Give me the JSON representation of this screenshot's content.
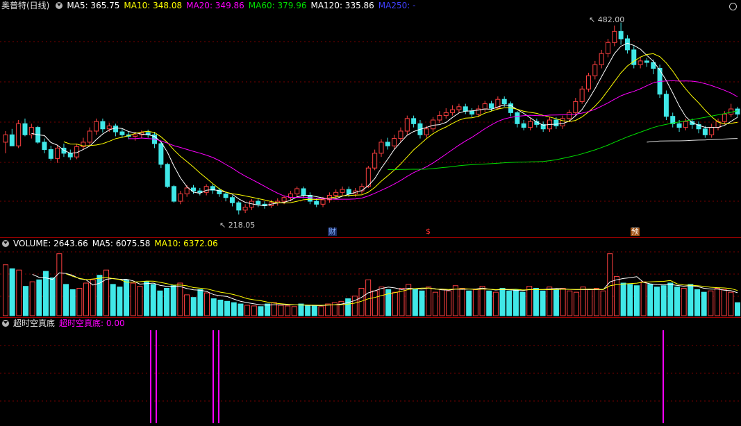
{
  "price_header": {
    "title": "奥普特(日线)",
    "items": [
      {
        "label": "MA5: 365.75",
        "color": "#ffffff"
      },
      {
        "label": "MA10: 348.08",
        "color": "#ffff00"
      },
      {
        "label": "MA20: 349.86",
        "color": "#ff00ff"
      },
      {
        "label": "MA60: 379.96",
        "color": "#00e000"
      },
      {
        "label": "MA120: 335.86",
        "color": "#ffffff"
      },
      {
        "label": "MA250: -",
        "color": "#4040ff"
      }
    ]
  },
  "volume_header": {
    "items": [
      {
        "label": "VOLUME: 2643.66",
        "color": "#ffffff"
      },
      {
        "label": "MA5: 6075.58",
        "color": "#ffffff"
      },
      {
        "label": "MA10: 6372.06",
        "color": "#ffff00"
      }
    ]
  },
  "indicator_header": {
    "name": "超时空真底",
    "value_label": "超时空真底: 0.00",
    "value_color": "#ff00ff"
  },
  "annotations": {
    "high_label": "482.00",
    "low_label": "218.05"
  },
  "event_markers": [
    {
      "label": "财",
      "color": "#80b0ff",
      "bg": "#1a2a60"
    },
    {
      "label": "$",
      "color": "#ff3030",
      "bg": "transparent"
    },
    {
      "label": "预",
      "color": "#ffffff",
      "bg": "#a05010"
    }
  ],
  "colors": {
    "up": "#ff4040",
    "down": "#40e8e8",
    "grid": "#7a0000",
    "signal": "#ff00ff"
  },
  "chart_data": {
    "type": "candlestick",
    "price_range": [
      218.05,
      482.0
    ],
    "candles": [
      [
        320,
        330,
        305,
        335,
        300
      ],
      [
        330,
        315,
        318,
        338,
        312
      ],
      [
        315,
        345,
        312,
        350,
        310
      ],
      [
        345,
        330,
        328,
        352,
        325
      ],
      [
        330,
        340,
        325,
        345,
        320
      ],
      [
        340,
        320,
        318,
        342,
        315
      ],
      [
        320,
        310,
        305,
        325,
        300
      ],
      [
        310,
        298,
        295,
        315,
        290
      ],
      [
        298,
        312,
        292,
        316,
        290
      ],
      [
        312,
        305,
        300,
        318,
        298
      ],
      [
        305,
        300,
        296,
        310,
        295
      ],
      [
        300,
        314,
        297,
        318,
        295
      ],
      [
        314,
        320,
        310,
        326,
        306
      ],
      [
        320,
        335,
        315,
        340,
        312
      ],
      [
        335,
        348,
        330,
        352,
        326
      ],
      [
        348,
        338,
        333,
        352,
        330
      ],
      [
        338,
        342,
        334,
        346,
        330
      ],
      [
        342,
        334,
        328,
        345,
        325
      ],
      [
        334,
        330,
        326,
        338,
        322
      ],
      [
        330,
        328,
        324,
        334,
        320
      ],
      [
        328,
        330,
        322,
        334,
        318
      ],
      [
        330,
        333,
        326,
        336,
        322
      ],
      [
        333,
        330,
        326,
        337,
        324
      ],
      [
        330,
        318,
        312,
        334,
        308
      ],
      [
        318,
        290,
        285,
        320,
        280
      ],
      [
        290,
        260,
        258,
        292,
        255
      ],
      [
        260,
        240,
        238,
        262,
        232
      ],
      [
        240,
        250,
        236,
        254,
        234
      ],
      [
        250,
        258,
        246,
        262,
        244
      ],
      [
        258,
        254,
        250,
        262,
        248
      ],
      [
        254,
        252,
        248,
        258,
        246
      ],
      [
        252,
        260,
        248,
        263,
        246
      ],
      [
        260,
        255,
        250,
        263,
        248
      ],
      [
        255,
        250,
        246,
        258,
        244
      ],
      [
        250,
        245,
        240,
        253,
        238
      ],
      [
        245,
        238,
        233,
        248,
        230
      ],
      [
        238,
        228,
        222,
        240,
        218
      ],
      [
        228,
        232,
        224,
        236,
        222
      ],
      [
        232,
        240,
        228,
        243,
        226
      ],
      [
        240,
        236,
        232,
        244,
        230
      ],
      [
        236,
        234,
        230,
        240,
        228
      ],
      [
        234,
        238,
        231,
        242,
        229
      ],
      [
        238,
        240,
        234,
        244,
        232
      ],
      [
        240,
        245,
        236,
        248,
        234
      ],
      [
        245,
        250,
        240,
        254,
        238
      ],
      [
        250,
        257,
        246,
        260,
        244
      ],
      [
        257,
        248,
        244,
        260,
        242
      ],
      [
        248,
        240,
        236,
        252,
        234
      ],
      [
        240,
        236,
        232,
        244,
        230
      ],
      [
        236,
        242,
        232,
        246,
        230
      ],
      [
        242,
        248,
        238,
        252,
        236
      ],
      [
        248,
        252,
        244,
        256,
        242
      ],
      [
        252,
        256,
        248,
        260,
        246
      ],
      [
        256,
        250,
        246,
        260,
        244
      ],
      [
        250,
        254,
        246,
        258,
        244
      ],
      [
        254,
        260,
        250,
        264,
        248
      ],
      [
        260,
        285,
        258,
        288,
        256
      ],
      [
        285,
        305,
        282,
        310,
        280
      ],
      [
        305,
        320,
        300,
        324,
        298
      ],
      [
        320,
        315,
        310,
        326,
        308
      ],
      [
        315,
        325,
        310,
        330,
        308
      ],
      [
        325,
        335,
        320,
        340,
        318
      ],
      [
        335,
        352,
        330,
        356,
        328
      ],
      [
        352,
        345,
        340,
        356,
        338
      ],
      [
        345,
        330,
        325,
        350,
        322
      ],
      [
        330,
        338,
        326,
        342,
        324
      ],
      [
        338,
        350,
        334,
        354,
        330
      ],
      [
        350,
        356,
        346,
        362,
        344
      ],
      [
        356,
        360,
        352,
        366,
        350
      ],
      [
        360,
        364,
        356,
        370,
        354
      ],
      [
        364,
        368,
        360,
        372,
        356
      ],
      [
        368,
        362,
        358,
        372,
        355
      ],
      [
        362,
        358,
        354,
        366,
        350
      ],
      [
        358,
        365,
        354,
        370,
        352
      ],
      [
        365,
        372,
        361,
        376,
        358
      ],
      [
        372,
        366,
        362,
        376,
        360
      ],
      [
        366,
        378,
        364,
        382,
        362
      ],
      [
        378,
        372,
        368,
        382,
        365
      ],
      [
        372,
        360,
        355,
        375,
        350
      ],
      [
        360,
        345,
        340,
        362,
        338
      ],
      [
        345,
        340,
        336,
        350,
        334
      ],
      [
        340,
        348,
        336,
        352,
        334
      ],
      [
        348,
        344,
        340,
        352,
        338
      ],
      [
        344,
        338,
        334,
        348,
        332
      ],
      [
        338,
        350,
        334,
        354,
        332
      ],
      [
        350,
        342,
        338,
        354,
        336
      ],
      [
        342,
        352,
        338,
        356,
        336
      ],
      [
        352,
        360,
        348,
        364,
        346
      ],
      [
        360,
        375,
        356,
        380,
        354
      ],
      [
        375,
        392,
        372,
        396,
        370
      ],
      [
        392,
        410,
        388,
        414,
        386
      ],
      [
        410,
        425,
        405,
        430,
        402
      ],
      [
        425,
        440,
        420,
        445,
        418
      ],
      [
        440,
        455,
        435,
        460,
        432
      ],
      [
        455,
        470,
        450,
        478,
        448
      ],
      [
        470,
        460,
        452,
        482,
        450
      ],
      [
        460,
        445,
        440,
        465,
        436
      ],
      [
        445,
        425,
        420,
        450,
        418
      ],
      [
        425,
        430,
        420,
        436,
        418
      ],
      [
        430,
        428,
        422,
        434,
        420
      ],
      [
        428,
        420,
        412,
        432,
        408
      ],
      [
        420,
        385,
        380,
        425,
        378
      ],
      [
        385,
        355,
        350,
        390,
        345
      ],
      [
        355,
        345,
        340,
        360,
        336
      ],
      [
        345,
        340,
        334,
        350,
        330
      ],
      [
        340,
        348,
        336,
        352,
        334
      ],
      [
        348,
        344,
        338,
        352,
        336
      ],
      [
        344,
        338,
        332,
        348,
        330
      ],
      [
        338,
        330,
        326,
        342,
        322
      ],
      [
        330,
        340,
        326,
        345,
        324
      ],
      [
        340,
        348,
        336,
        352,
        334
      ],
      [
        348,
        358,
        344,
        362,
        342
      ],
      [
        358,
        365,
        354,
        372,
        352
      ],
      [
        365,
        358,
        354,
        368,
        350
      ]
    ],
    "volume_bars": [
      78,
      72,
      70,
      45,
      52,
      55,
      68,
      58,
      95,
      48,
      40,
      42,
      50,
      55,
      62,
      70,
      48,
      44,
      55,
      50,
      45,
      52,
      48,
      38,
      42,
      46,
      50,
      32,
      28,
      40,
      35,
      26,
      24,
      22,
      20,
      18,
      16,
      15,
      14,
      18,
      20,
      16,
      15,
      14,
      18,
      16,
      15,
      14,
      18,
      20,
      22,
      26,
      30,
      42,
      55,
      38,
      44,
      40,
      36,
      42,
      48,
      40,
      38,
      44,
      36,
      40,
      38,
      46,
      42,
      38,
      40,
      45,
      38,
      36,
      42,
      38,
      40,
      36,
      45,
      42,
      38,
      44,
      40,
      42,
      38,
      36,
      44,
      40,
      42,
      38,
      95,
      60,
      50,
      48,
      46,
      52,
      48,
      44,
      46,
      50,
      44,
      42,
      48,
      40,
      36,
      38,
      42,
      40,
      36,
      20
    ],
    "signal_positions": [
      217,
      225,
      307,
      315,
      955
    ]
  }
}
